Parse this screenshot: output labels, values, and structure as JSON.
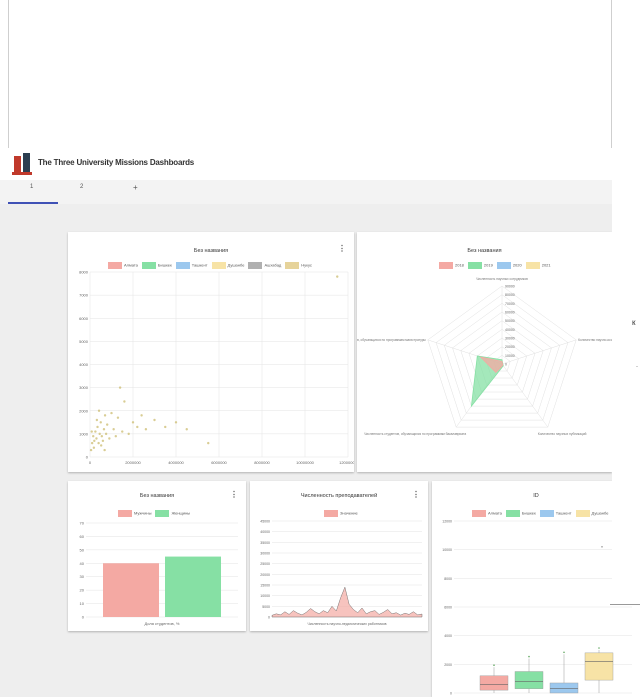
{
  "app": {
    "title": "The Three University Missions Dashboards"
  },
  "tabs": [
    {
      "label": "1"
    },
    {
      "label": "2"
    },
    {
      "label": "+"
    }
  ],
  "side": {
    "letter": "к",
    "dash": "-"
  },
  "colors": {
    "red": "#f4a9a3",
    "green": "#86e0a4",
    "blue": "#9cc8ee",
    "yellow": "#f7e3a6",
    "gray": "#b0b0b0",
    "tan": "#e6d39a",
    "accent": "#3f51b5"
  },
  "scatter_card": {
    "title": "Без названия",
    "menu": "⋮",
    "legend": [
      "Алмата",
      "Бишкек",
      "Ташкент",
      "Душанбе",
      "Ашхабад",
      "Нукус"
    ]
  },
  "radar_card": {
    "title": "Без названия",
    "legend": [
      "2018",
      "2019",
      "2020",
      "2021"
    ],
    "axis_labels": [
      "Численность научных сотрудников",
      "Количество научно-исследовательских работ",
      "Количество научных публикаций",
      "Численность студентов, обучающихся по программам бакалавриата",
      "Численность студентов, обучающихся по программам магистратуры"
    ]
  },
  "bar_card": {
    "title": "Без названия",
    "menu": "⋮",
    "legend": [
      "Мужчины",
      "Женщины"
    ],
    "xlabel": "Доля студентов, %"
  },
  "hist_card": {
    "title": "Численность преподавателей",
    "menu": "⋮",
    "legend": [
      "Значение"
    ],
    "xlabel": "Численность научно-педагогических работников"
  },
  "box_card": {
    "title": "ID",
    "legend": [
      "Алмата",
      "Бишкек",
      "Ташкент",
      "Душанбе"
    ]
  },
  "chart_data": [
    {
      "type": "scatter",
      "title": "Без названия",
      "xlim": [
        0,
        12000000
      ],
      "ylim": [
        0,
        8000
      ],
      "x_ticks": [
        "0",
        "2000000",
        "4000000",
        "6000000",
        "8000000",
        "10000000",
        "12000000"
      ],
      "y_ticks": [
        "0",
        "1000",
        "2000",
        "3000",
        "4000",
        "5000",
        "6000",
        "7000",
        "8000"
      ],
      "grid": true,
      "legend_position": "top",
      "series": [
        {
          "name": "Алмата",
          "color": "#f4a9a3"
        },
        {
          "name": "Бишкек",
          "color": "#86e0a4"
        },
        {
          "name": "Ташкент",
          "color": "#9cc8ee"
        },
        {
          "name": "Душанбе",
          "color": "#f7e3a6"
        },
        {
          "name": "Ашхабад",
          "color": "#b0b0b0"
        },
        {
          "name": "Нукус",
          "color": "#e6d39a"
        }
      ],
      "points": [
        [
          100000,
          600
        ],
        [
          150000,
          900
        ],
        [
          200000,
          700
        ],
        [
          250000,
          1100
        ],
        [
          300000,
          800
        ],
        [
          350000,
          1300
        ],
        [
          400000,
          600
        ],
        [
          450000,
          1000
        ],
        [
          500000,
          1500
        ],
        [
          550000,
          900
        ],
        [
          600000,
          700
        ],
        [
          650000,
          1200
        ],
        [
          700000,
          1800
        ],
        [
          750000,
          1000
        ],
        [
          800000,
          1400
        ],
        [
          900000,
          800
        ],
        [
          1000000,
          1900
        ],
        [
          1100000,
          1200
        ],
        [
          1200000,
          900
        ],
        [
          1300000,
          1700
        ],
        [
          1400000,
          3000
        ],
        [
          1500000,
          1100
        ],
        [
          1600000,
          2400
        ],
        [
          1800000,
          1000
        ],
        [
          2000000,
          1500
        ],
        [
          2200000,
          1300
        ],
        [
          2400000,
          1800
        ],
        [
          2600000,
          1200
        ],
        [
          3000000,
          1600
        ],
        [
          3500000,
          1300
        ],
        [
          4000000,
          1500
        ],
        [
          4500000,
          1200
        ],
        [
          5500000,
          600
        ],
        [
          50000,
          300
        ],
        [
          80000,
          1100
        ],
        [
          180000,
          400
        ],
        [
          320000,
          1600
        ],
        [
          420000,
          2000
        ],
        [
          520000,
          500
        ],
        [
          680000,
          300
        ],
        [
          11500000,
          7800
        ]
      ]
    },
    {
      "type": "radar",
      "title": "Без названия",
      "r_ticks": [
        "0",
        "10000",
        "20000",
        "30000",
        "40000",
        "50000",
        "60000",
        "70000",
        "80000",
        "90000"
      ],
      "rmax": 90000,
      "legend_position": "top",
      "series": [
        {
          "name": "2018",
          "color": "#f4a9a3",
          "values": [
            3000,
            500,
            1500,
            12000,
            26000
          ]
        },
        {
          "name": "2019",
          "color": "#86e0a4",
          "values": [
            5000,
            1000,
            2500,
            60000,
            30000
          ]
        },
        {
          "name": "2020",
          "color": "#9cc8ee",
          "values": [
            0,
            0,
            0,
            0,
            0
          ]
        },
        {
          "name": "2021",
          "color": "#f7e3a6",
          "values": [
            0,
            0,
            0,
            0,
            0
          ]
        }
      ]
    },
    {
      "type": "bar",
      "title": "Без названия",
      "categories": [
        "Доля студентов, %"
      ],
      "ylim": [
        0,
        70
      ],
      "y_ticks": [
        "0",
        "10",
        "20",
        "30",
        "40",
        "50",
        "60",
        "70"
      ],
      "series": [
        {
          "name": "Мужчины",
          "color": "#f4a9a3",
          "values": [
            40
          ]
        },
        {
          "name": "Женщины",
          "color": "#86e0a4",
          "values": [
            45
          ]
        }
      ]
    },
    {
      "type": "area",
      "title": "Численность преподавателей",
      "ylim": [
        0,
        45000
      ],
      "y_ticks": [
        "0",
        "5000",
        "10000",
        "15000",
        "20000",
        "25000",
        "30000",
        "35000",
        "40000",
        "45000"
      ],
      "series": [
        {
          "name": "Значение",
          "color": "#f4a9a3"
        }
      ],
      "values": [
        800,
        1500,
        1000,
        2500,
        1200,
        3000,
        1800,
        1000,
        2200,
        4000,
        2500,
        1500,
        3000,
        2000,
        5000,
        2800,
        9000,
        14000,
        6000,
        3500,
        2000,
        4200,
        1500,
        2500,
        3000,
        1200,
        2200,
        3500,
        1500,
        2000,
        900,
        1800,
        1200,
        2500,
        1000,
        1400
      ]
    },
    {
      "type": "box",
      "title": "ID",
      "ylim": [
        0,
        12000
      ],
      "y_ticks": [
        "0",
        "2000",
        "4000",
        "6000",
        "8000",
        "10000",
        "12000"
      ],
      "series": [
        {
          "name": "Алмата",
          "color": "#f4a9a3",
          "q1": 200,
          "median": 600,
          "q3": 1200,
          "min": 0,
          "max": 1800
        },
        {
          "name": "Бишкек",
          "color": "#86e0a4",
          "q1": 300,
          "median": 800,
          "q3": 1500,
          "min": 0,
          "max": 2400
        },
        {
          "name": "Ташкент",
          "color": "#9cc8ee",
          "q1": 0,
          "median": 300,
          "q3": 700,
          "min": 0,
          "max": 2700
        },
        {
          "name": "Душанбе",
          "color": "#f7e3a6",
          "q1": 900,
          "median": 2200,
          "q3": 2800,
          "min": 0,
          "max": 3000
        }
      ]
    }
  ]
}
